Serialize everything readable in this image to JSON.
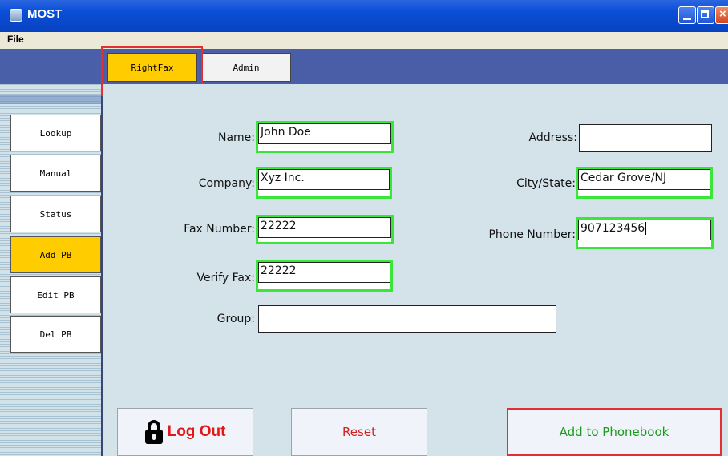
{
  "window": {
    "title": "MOST"
  },
  "menu": {
    "file": "File"
  },
  "tabs": [
    {
      "label": "RightFax",
      "active": true
    },
    {
      "label": "Admin",
      "active": false
    }
  ],
  "sidebar": {
    "items": [
      {
        "label": "Lookup",
        "active": false
      },
      {
        "label": "Manual",
        "active": false
      },
      {
        "label": "Status",
        "active": false
      },
      {
        "label": "Add PB",
        "active": true
      },
      {
        "label": "Edit PB",
        "active": false
      },
      {
        "label": "Del PB",
        "active": false
      }
    ]
  },
  "form": {
    "name": {
      "label": "Name:",
      "value": "John Doe"
    },
    "company": {
      "label": "Company:",
      "value": "Xyz Inc."
    },
    "fax_number": {
      "label": "Fax Number:",
      "value": "22222"
    },
    "verify_fax": {
      "label": "Verify Fax:",
      "value": "22222"
    },
    "group": {
      "label": "Group:",
      "value": ""
    },
    "address": {
      "label": "Address:",
      "value": ""
    },
    "city_state": {
      "label": "City/State:",
      "value": "Cedar Grove/NJ"
    },
    "phone_number": {
      "label": "Phone Number:",
      "value": "907123456"
    }
  },
  "buttons": {
    "logout": "Log Out",
    "reset": "Reset",
    "add_to_phonebook": "Add to Phonebook"
  },
  "colors": {
    "accent_yellow": "#ffcc00",
    "highlight_red": "#e23030",
    "field_green": "#39e639",
    "titlebar_blue": "#0a4fd6"
  }
}
